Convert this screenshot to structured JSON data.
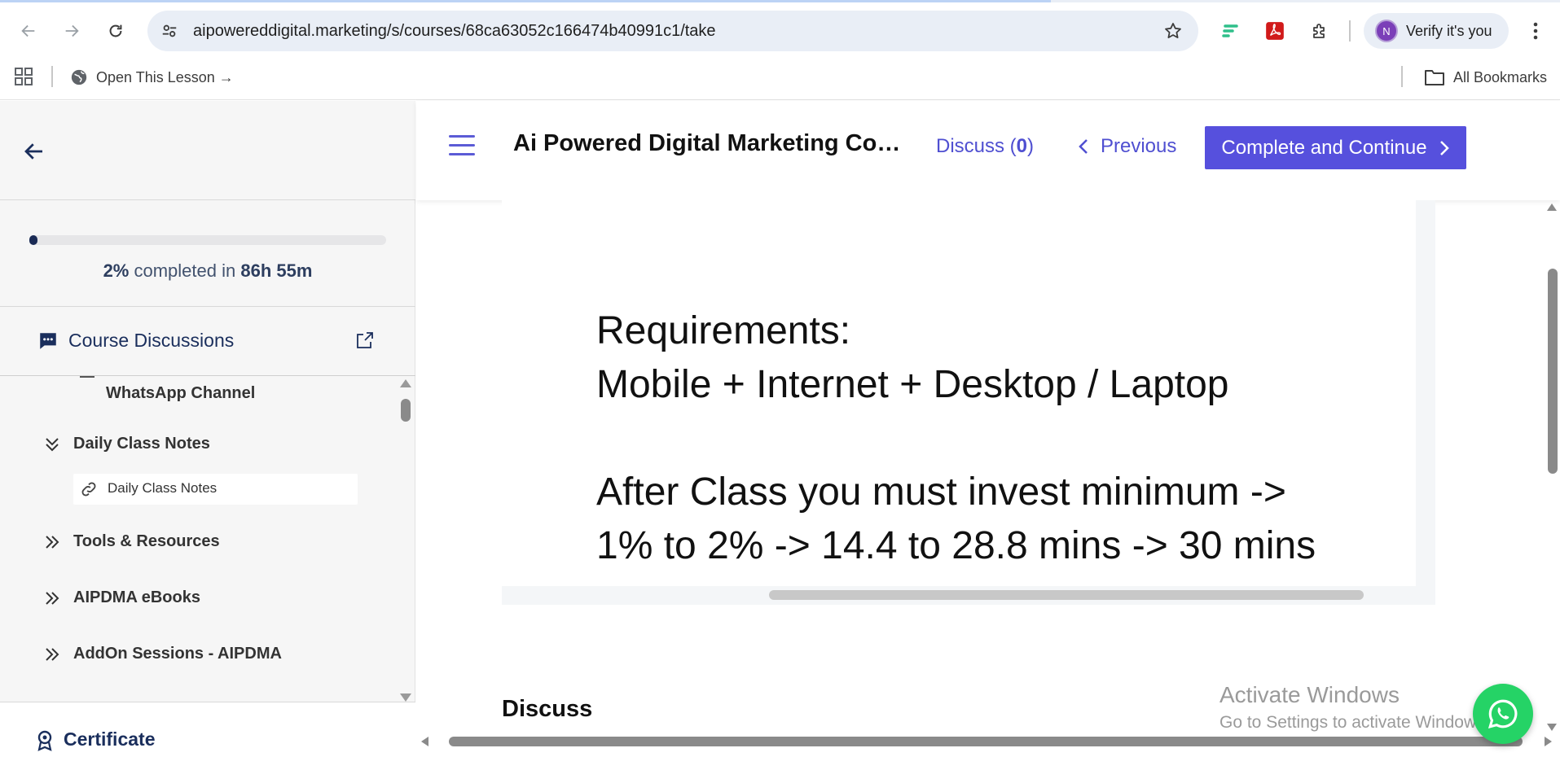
{
  "browser": {
    "url": "aipowereddigital.marketing/s/courses/68ca63052c166474b40991c1/take",
    "profile": {
      "initial": "N",
      "label": "Verify it's you"
    },
    "bookmarks": {
      "item": "Open This Lesson →",
      "all": "All Bookmarks"
    }
  },
  "sidebar": {
    "progress": {
      "percent_value": 0.02,
      "percent": "2%",
      "middle": "completed in",
      "time": "86h 55m"
    },
    "discussions_label": "Course Discussions",
    "partial_item": "WhatsApp Channel",
    "sections": [
      {
        "label": "Daily Class Notes",
        "expanded": true
      },
      {
        "label": "Tools & Resources",
        "expanded": false
      },
      {
        "label": "AIPDMA eBooks",
        "expanded": false
      },
      {
        "label": "AddOn Sessions - AIPDMA",
        "expanded": false
      }
    ],
    "lesson": {
      "label": "Daily Class Notes",
      "icon": "link-icon"
    },
    "certificate_label": "Certificate"
  },
  "header": {
    "course_title": "Ai Powered Digital Marketing Course",
    "discuss_label": "Discuss (",
    "discuss_count": "0",
    "discuss_close": ")",
    "previous_label": "Previous",
    "cta_label": "Complete and Continue"
  },
  "content": {
    "lines": [
      "Requirements:",
      "Mobile + Internet + Desktop / Laptop",
      "",
      "After Class you must invest minimum ->",
      "1% to 2% -> 14.4 to 28.8 mins -> 30 mins"
    ]
  },
  "discuss_heading": "Discuss",
  "watermark": {
    "title": "Activate Windows",
    "subtitle": "Go to Settings to activate Windows."
  },
  "colors": {
    "accent": "#5650dd",
    "progress": "#1a2b55",
    "whatsapp": "#25d366"
  }
}
